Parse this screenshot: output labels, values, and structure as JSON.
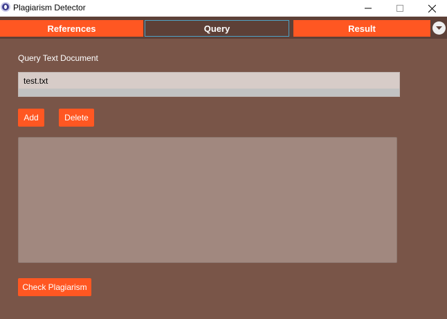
{
  "window": {
    "title": "Plagiarism Detector",
    "icons": {
      "app": "app-logo-icon",
      "minimize": "minimize-icon",
      "maximize": "maximize-icon",
      "close": "close-icon"
    }
  },
  "tabs": [
    {
      "label": "References",
      "selected": false
    },
    {
      "label": "Query",
      "selected": true
    },
    {
      "label": "Result",
      "selected": false
    }
  ],
  "tab_menu_icon": "chevron-down-icon",
  "query": {
    "section_label": "Query Text Document",
    "files": [
      "test.txt"
    ],
    "add_label": "Add",
    "delete_label": "Delete",
    "text_area_placeholder": "",
    "check_label": "Check Plagiarism"
  },
  "colors": {
    "background": "#795548",
    "tab_bar": "#5d4037",
    "accent": "#ff5722",
    "list_background": "#d7ccc8",
    "text_area": "#a1887f"
  }
}
